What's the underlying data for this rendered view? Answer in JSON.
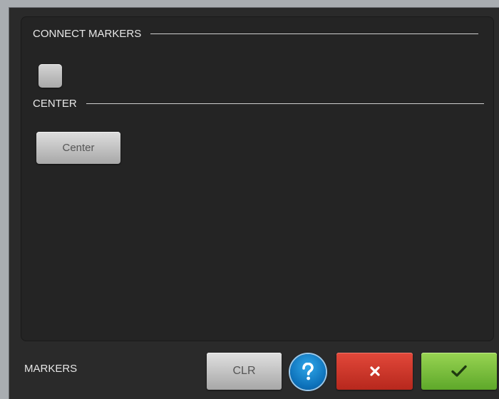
{
  "dialog": {
    "footer_title": "MARKERS",
    "accent_colors": {
      "help": "#1a86d0",
      "cancel": "#d23a2d",
      "ok": "#7cc242"
    }
  },
  "sections": [
    {
      "title": "CONNECT MARKERS",
      "control": {
        "type": "checkbox",
        "checked": false
      }
    },
    {
      "title": "CENTER",
      "control": {
        "type": "button",
        "label": "Center"
      }
    }
  ],
  "footer": {
    "clear_label": "CLR",
    "help_icon": "question-mark-icon",
    "cancel_icon": "close-icon",
    "ok_icon": "checkmark-icon"
  }
}
